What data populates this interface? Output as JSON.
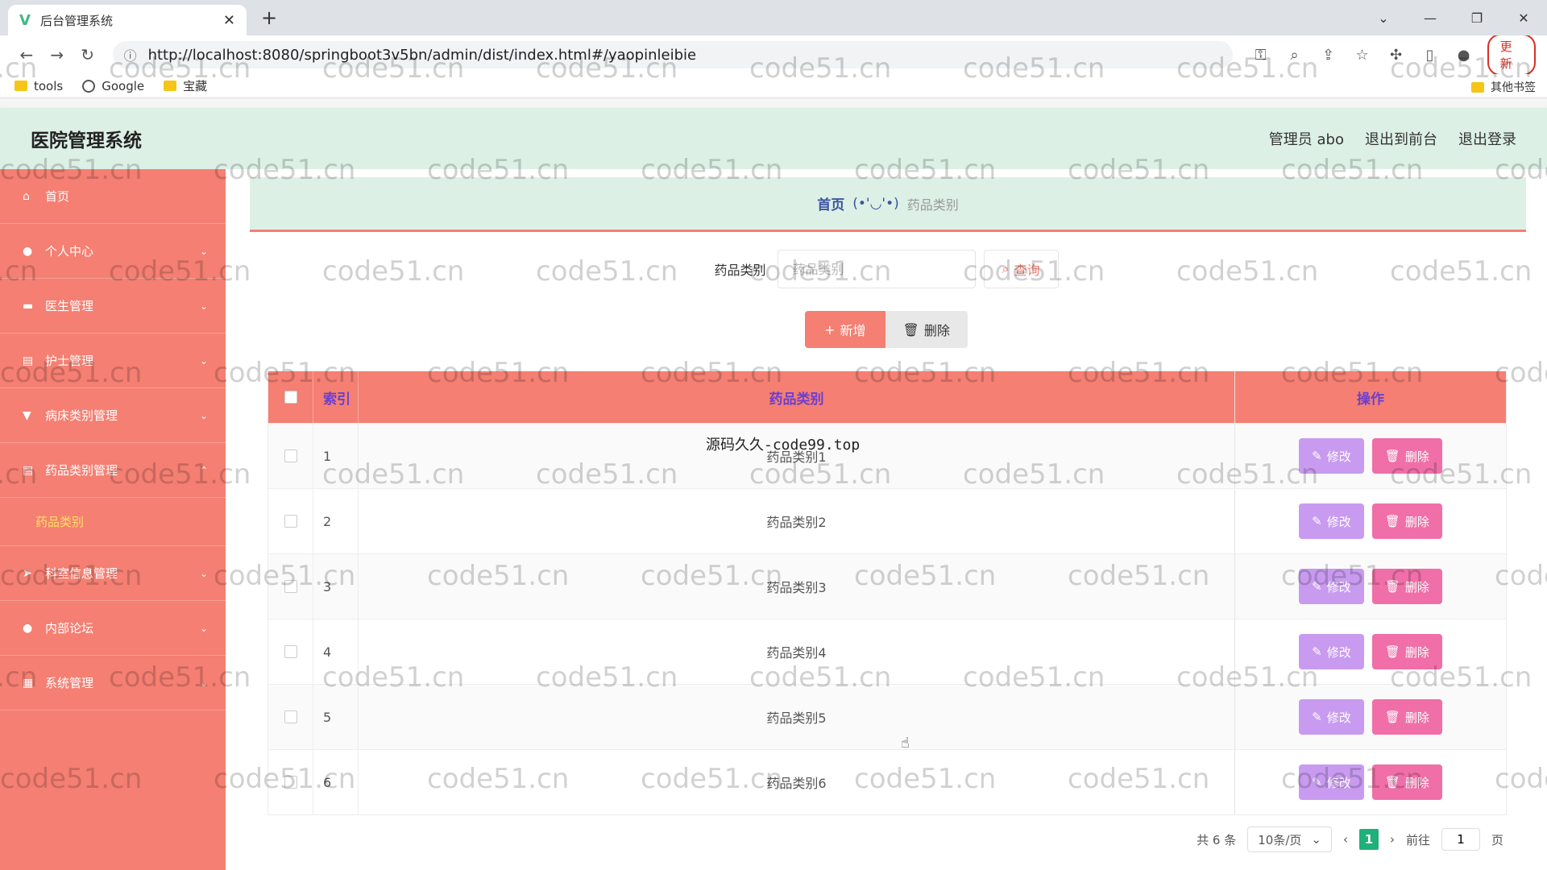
{
  "browser": {
    "tab_title": "后台管理系统",
    "url": "http://localhost:8080/springboot3v5bn/admin/dist/index.html#/yaopinleibie",
    "update_label": "更新",
    "bookmarks": [
      "tools",
      "Google",
      "宝藏"
    ],
    "other_bookmarks": "其他书签"
  },
  "app": {
    "title": "医院管理系统",
    "user_label": "管理员 abo",
    "back_front": "退出到前台",
    "logout": "退出登录"
  },
  "sidebar": {
    "items": [
      {
        "label": "首页",
        "icon": "home-icon"
      },
      {
        "label": "个人中心",
        "icon": "user-icon"
      },
      {
        "label": "医生管理",
        "icon": "briefcase-icon"
      },
      {
        "label": "护士管理",
        "icon": "clipboard-icon"
      },
      {
        "label": "病床类别管理",
        "icon": "trophy-icon"
      },
      {
        "label": "药品类别管理",
        "icon": "clipboard-icon"
      },
      {
        "label": "科室信息管理",
        "icon": "send-icon"
      },
      {
        "label": "内部论坛",
        "icon": "location-icon"
      },
      {
        "label": "系统管理",
        "icon": "grid-icon"
      }
    ],
    "sub_item": "药品类别"
  },
  "breadcrumb": {
    "home": "首页",
    "face": "(•'◡'•)",
    "current": "药品类别"
  },
  "search": {
    "label": "药品类别",
    "placeholder": "药品类别",
    "query_label": "查询"
  },
  "actions": {
    "add_label": "新增",
    "delete_label": "删除"
  },
  "table": {
    "headers": {
      "index": "索引",
      "name": "药品类别",
      "ops": "操作"
    },
    "rows": [
      {
        "idx": "1",
        "name": "药品类别1"
      },
      {
        "idx": "2",
        "name": "药品类别2"
      },
      {
        "idx": "3",
        "name": "药品类别3"
      },
      {
        "idx": "4",
        "name": "药品类别4"
      },
      {
        "idx": "5",
        "name": "药品类别5"
      },
      {
        "idx": "6",
        "name": "药品类别6"
      }
    ],
    "edit_label": "修改",
    "delete_label": "删除"
  },
  "pager": {
    "total": "共 6 条",
    "page_size": "10条/页",
    "current_page": "1",
    "goto_prefix": "前往",
    "goto_value": "1",
    "goto_suffix": "页"
  },
  "overlay_text": "源码久久-code99.top",
  "watermark": "code51.cn",
  "colors": {
    "accent": "#f47f72",
    "header_bg": "#ddf0e6",
    "edit": "#c89bf0",
    "delete": "#f06fa8",
    "page_active": "#20b07a"
  }
}
